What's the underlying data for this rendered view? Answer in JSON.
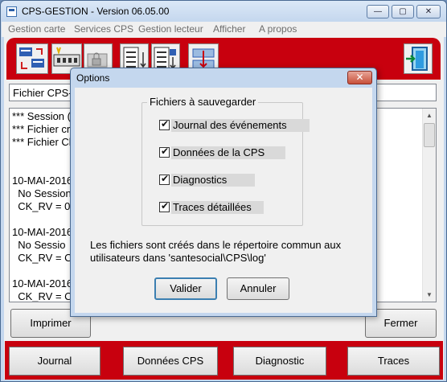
{
  "window": {
    "title": "CPS-GESTION - Version 06.05.00",
    "controls": {
      "minimize": "—",
      "maximize": "▢",
      "close": "✕"
    }
  },
  "menu": [
    {
      "label": "Gestion carte"
    },
    {
      "label": "Services CPS"
    },
    {
      "label": "Gestion lecteur"
    },
    {
      "label": "Afficher"
    },
    {
      "label": "A propos"
    }
  ],
  "toolbar_icons": [
    "card-transfer-icon",
    "card-reader-icon",
    "locked-card-icon",
    "sort-list-icon",
    "sort-list-alt-icon",
    "settings-transfer-icon",
    "exit-door-icon"
  ],
  "file_path": "Fichier CPS-",
  "log_lines": [
    "*** Session (",
    "*** Fichier cr",
    "*** Fichier Cl",
    "",
    "10-MAI-2016",
    "  No Session",
    "  CK_RV = 0",
    "",
    "10-MAI-2016",
    "  No Sessio",
    "  CK_RV = C",
    "",
    "10-MAI-2016",
    "  CK_RV = C"
  ],
  "buttons": {
    "print": "Imprimer",
    "close": "Fermer"
  },
  "bottom_tabs": [
    "Journal",
    "Données CPS",
    "Diagnostic",
    "Traces"
  ],
  "dialog": {
    "title": "Options",
    "close": "✕",
    "group_label": "Fichiers à sauvegarder",
    "options": [
      {
        "label": "Journal des événements",
        "checked": true
      },
      {
        "label": "Données de la CPS",
        "checked": true
      },
      {
        "label": "Diagnostics",
        "checked": true
      },
      {
        "label": "Traces détaillées",
        "checked": true
      }
    ],
    "note": "Les fichiers sont créés dans le répertoire commun aux utilisateurs dans 'santesocial\\CPS\\log'",
    "ok": "Valider",
    "cancel": "Annuler"
  },
  "colors": {
    "accent_red": "#c8000e",
    "frame_blue": "#c4d7ee"
  }
}
